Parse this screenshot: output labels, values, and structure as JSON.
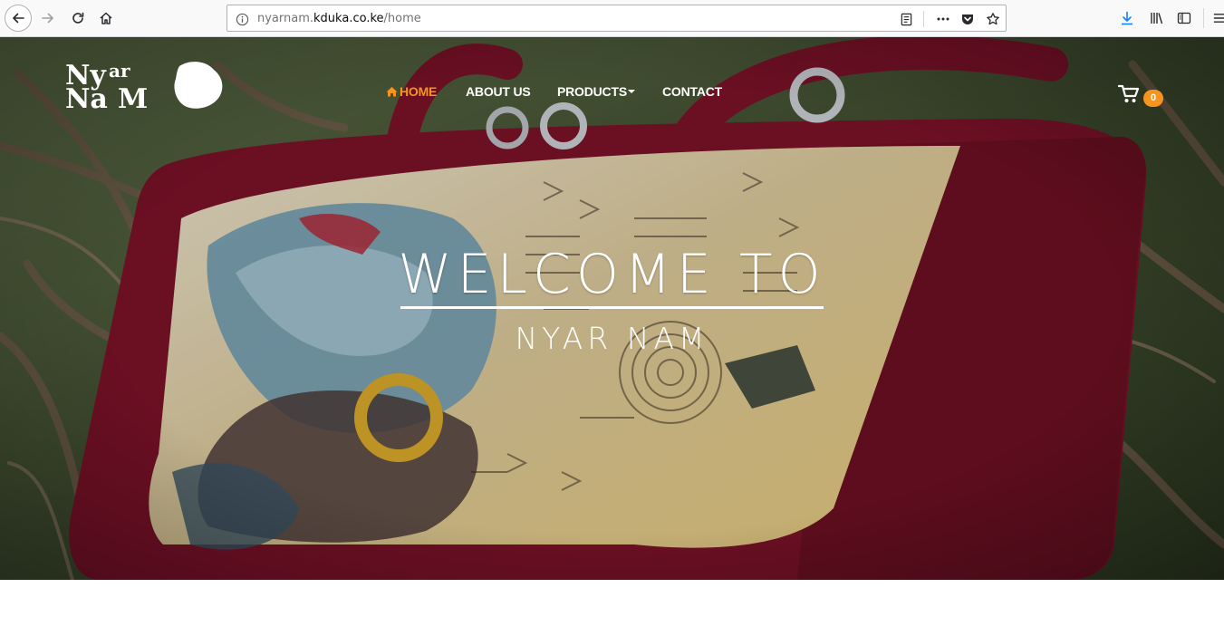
{
  "browser": {
    "url_prefix": "nyarnam.",
    "url_host": "kduka.co.ke",
    "url_path": "/home"
  },
  "site": {
    "logo_alt": "Nyar Nam",
    "nav": [
      {
        "label": "HOME",
        "active": true
      },
      {
        "label": "ABOUT US"
      },
      {
        "label": "PRODUCTS",
        "has_dropdown": true
      },
      {
        "label": "CONTACT"
      }
    ],
    "cart_count": "0",
    "accent_color": "#f7941d"
  },
  "hero": {
    "title": "WELCOME TO",
    "subtitle": "NYAR NAM"
  }
}
